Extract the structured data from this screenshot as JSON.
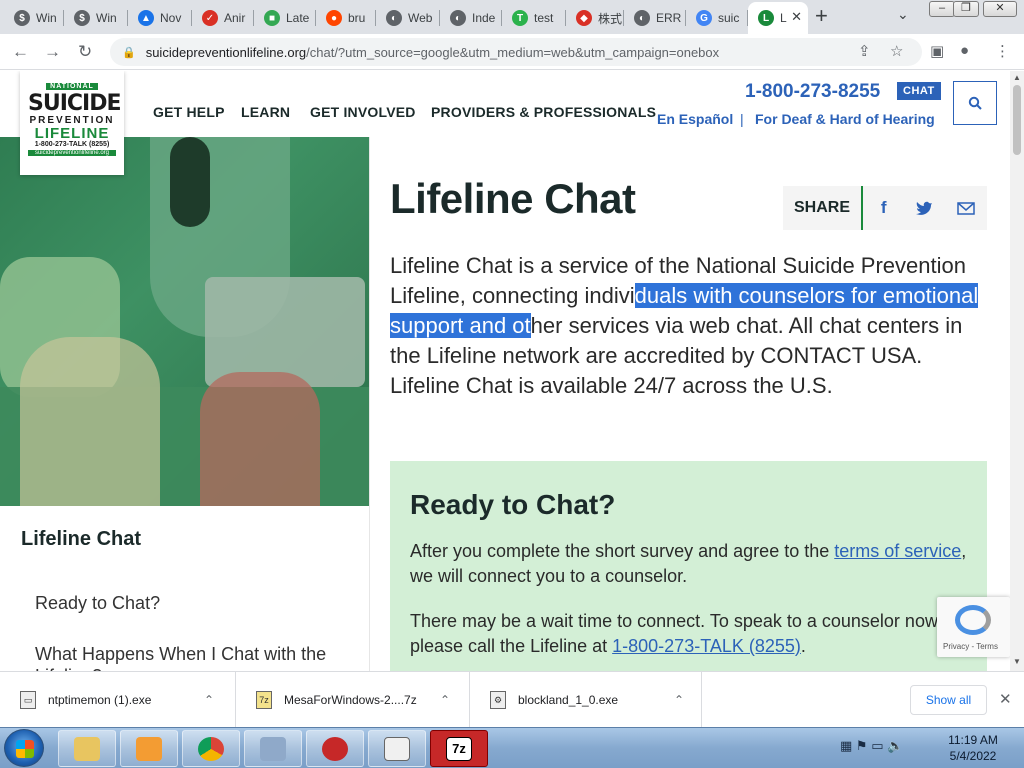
{
  "browser": {
    "tabs": [
      {
        "title": "Win",
        "color": "#5f6368",
        "glyph": "$"
      },
      {
        "title": "Win",
        "color": "#5f6368",
        "glyph": "$"
      },
      {
        "title": "Nov",
        "color": "#1a73e8",
        "glyph": "▲"
      },
      {
        "title": "Anir",
        "color": "#d93025",
        "glyph": "✓"
      },
      {
        "title": "Late",
        "color": "#34a853",
        "glyph": "■"
      },
      {
        "title": "bru",
        "color": "#ff4500",
        "glyph": "●"
      },
      {
        "title": "Web",
        "color": "#5f6368",
        "glyph": "◐"
      },
      {
        "title": "Inde",
        "color": "#5f6368",
        "glyph": "◐"
      },
      {
        "title": "test",
        "color": "#2bb24c",
        "glyph": "T"
      },
      {
        "title": "株式",
        "color": "#d93025",
        "glyph": "◆"
      },
      {
        "title": "ERR",
        "color": "#5f6368",
        "glyph": "◐"
      },
      {
        "title": "suic",
        "color": "#4285f4",
        "glyph": "G"
      },
      {
        "title": "L",
        "color": "#1a8a3b",
        "glyph": "L",
        "active": true
      }
    ],
    "new_tab_label": "+",
    "tab_menu_label": "⌄",
    "window_controls": {
      "minimize": "–",
      "restore": "❐",
      "close": "✕"
    },
    "url_host": "suicidepreventionlifeline.org",
    "url_path": "/chat/?utm_source=google&utm_medium=web&utm_campaign=onebox"
  },
  "site": {
    "logo": {
      "national": "NATIONAL",
      "suicide": "SUICIDE",
      "prevention": "PREVENTION",
      "lifeline": "LIFELINE",
      "talk": "1-800-273-TALK (8255)",
      "url": "suicidepreventionlifeline.org"
    },
    "nav": [
      "GET HELP",
      "LEARN",
      "GET INVOLVED",
      "PROVIDERS & PROFESSIONALS"
    ],
    "phone": "1-800-273-8255",
    "chat_badge": "CHAT",
    "espanol": "En Español",
    "separator": "|",
    "deaf": "For Deaf & Hard of Hearing"
  },
  "sidebar": {
    "title": "Lifeline Chat",
    "links": [
      "Ready to Chat?",
      "What Happens When I Chat with the Lifeline?"
    ]
  },
  "main": {
    "title": "Lifeline Chat",
    "share_label": "SHARE",
    "intro_1": "Lifeline Chat is a service of the National Suicide Prevention Lifeline, connecting indivi",
    "intro_hl": "duals with counselors for emotional support and ot",
    "intro_2": "her services via web chat. All chat centers in the Lifeline network are accredited by CONTACT USA. Lifeline Chat is available 24/7 across the U.S.",
    "ready_title": "Ready to Chat?",
    "ready_p1_a": "After you complete the short survey and agree to the ",
    "ready_p1_link": "terms of service",
    "ready_p1_b": ", we will connect you to a counselor.",
    "ready_p2_a": "There may be a wait time to connect. To speak to a counselor now, please call the Lifeline at ",
    "ready_p2_link": "1-800-273-TALK (8255)",
    "ready_p2_b": ".",
    "recaptcha_text": "Privacy - Terms"
  },
  "downloads": {
    "items": [
      {
        "name": "ntptimemon (1).exe"
      },
      {
        "name": "MesaForWindows-2....7z"
      },
      {
        "name": "blockland_1_0.exe"
      }
    ],
    "show_all": "Show all"
  },
  "taskbar": {
    "time": "11:19 AM",
    "date": "5/4/2022"
  }
}
